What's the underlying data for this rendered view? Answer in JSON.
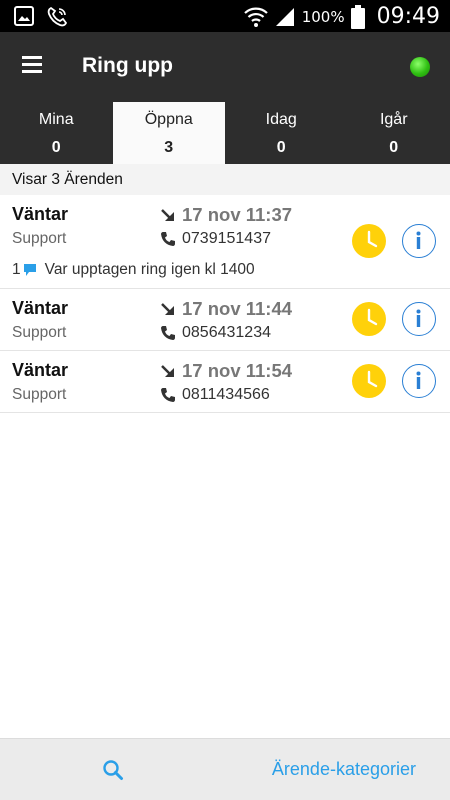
{
  "status_bar": {
    "battery_percent": "100%",
    "time": "09:49",
    "icons": [
      "image-icon",
      "call-icon",
      "wifi-icon",
      "signal-icon",
      "battery-icon"
    ]
  },
  "app_bar": {
    "title": "Ring upp",
    "menu_icon": "hamburger-icon",
    "connection_status_color": "#2fbf12"
  },
  "tabs": [
    {
      "label": "Mina",
      "count": "0",
      "active": false
    },
    {
      "label": "Öppna",
      "count": "3",
      "active": true
    },
    {
      "label": "Idag",
      "count": "0",
      "active": false
    },
    {
      "label": "Igår",
      "count": "0",
      "active": false
    }
  ],
  "list_header": "Visar 3 Ärenden",
  "cases": [
    {
      "status": "Väntar",
      "category": "Support",
      "date": "17 nov 11:37",
      "phone": "0739151437",
      "comment_count": "1",
      "comment": "Var upptagen ring igen kl 1400"
    },
    {
      "status": "Väntar",
      "category": "Support",
      "date": "17 nov 11:44",
      "phone": "0856431234"
    },
    {
      "status": "Väntar",
      "category": "Support",
      "date": "17 nov 11:54",
      "phone": "0811434566"
    }
  ],
  "bottom_bar": {
    "search_icon": "search-icon",
    "categories_label": "Ärende-kategorier"
  },
  "colors": {
    "accent": "#2a9fe8",
    "clock_button": "#ffd10a",
    "info_button": "#2a7fd4",
    "app_bar": "#2d2d2d"
  }
}
